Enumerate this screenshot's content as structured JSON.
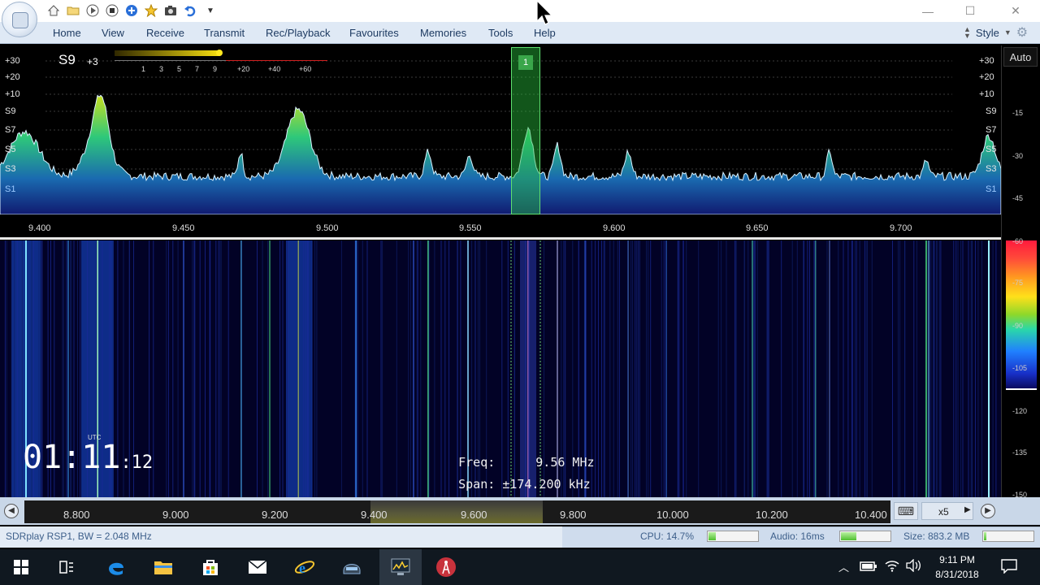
{
  "menu": {
    "items": [
      "Home",
      "View",
      "Receive",
      "Transmit",
      "Rec/Playback",
      "Favourites",
      "Memories",
      "Tools",
      "Help"
    ],
    "style_label": "Style"
  },
  "quick_access": [
    "home-icon",
    "folder-icon",
    "play-icon",
    "stop-icon",
    "add-icon",
    "favourite-star-icon",
    "camera-icon",
    "undo-icon"
  ],
  "spectrum": {
    "s_meter": {
      "reading": "S9",
      "over": "+3",
      "scale": [
        "1",
        "3",
        "5",
        "7",
        "9",
        "+20",
        "+40",
        "+60"
      ]
    },
    "level_labels_left": [
      "+30",
      "+20",
      "+10",
      "S9",
      "S7",
      "S5",
      "S3",
      "S1"
    ],
    "level_labels_right": [
      "+30",
      "+20",
      "+10",
      "S9",
      "S7",
      "S5",
      "S3",
      "S1"
    ],
    "freq_axis": [
      "9.400",
      "9.450",
      "9.500",
      "9.550",
      "9.600",
      "9.650",
      "9.700"
    ],
    "vfo_tag": "1"
  },
  "waterfall": {
    "utc_label": "UTC",
    "clock_hm_h": "01",
    "clock_colon": ":",
    "clock_hm_m": "11",
    "clock_sec": ":12",
    "freq_label": "Freq:",
    "freq_value": "9.56 MHz",
    "span_label": "Span:",
    "span_value": "±174.200 kHz"
  },
  "scale": {
    "auto_label": "Auto",
    "db_labels": [
      "-15",
      "-30",
      "-45",
      "-60",
      "-75",
      "-90",
      "-105",
      "-120",
      "-135",
      "-150"
    ]
  },
  "ruler": {
    "labels": [
      "8.800",
      "9.000",
      "9.200",
      "9.400",
      "9.600",
      "9.800",
      "10.000",
      "10.200",
      "10.400"
    ],
    "zoom": "x5"
  },
  "status": {
    "device": "SDRplay RSP1, BW = 2.048 MHz",
    "cpu_label": "CPU: 14.7%",
    "cpu_level": 0.147,
    "audio_label": "Audio: 16ms",
    "audio_level": 0.3,
    "size_label": "Size: 883.2 MB",
    "size_level": 0.05
  },
  "taskbar": {
    "time": "9:11 PM",
    "date": "8/31/2018"
  },
  "colors": {
    "menubar": "#dfe9f5",
    "spectrum_fill_top": "#3ad07a",
    "spectrum_fill_bottom": "#1a3a9a",
    "vfo": "#3aa64a"
  }
}
